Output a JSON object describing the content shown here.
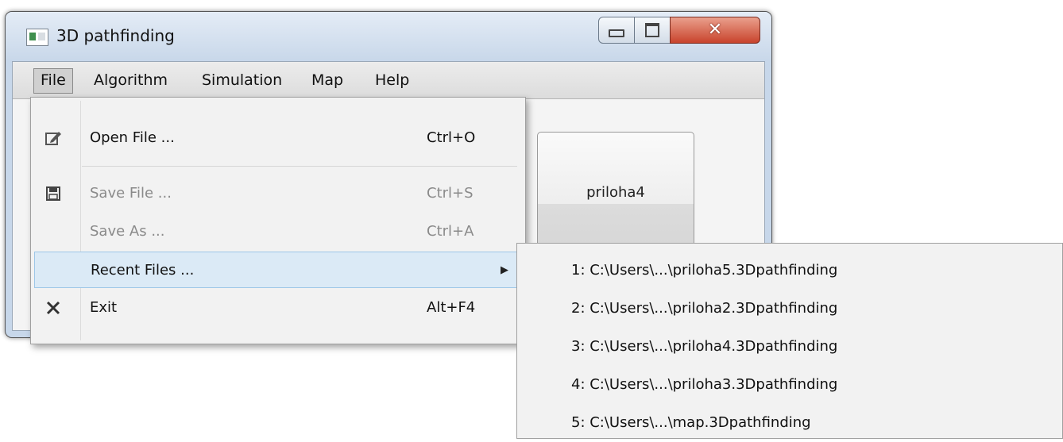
{
  "window": {
    "title": "3D pathfinding",
    "icon": "app-window-icon",
    "controls": {
      "minimize": "minimize-icon",
      "maximize": "maximize-icon",
      "close": "✕"
    }
  },
  "menubar": {
    "items": [
      "File",
      "Algorithm",
      "Simulation",
      "Map",
      "Help"
    ],
    "active": "File"
  },
  "content": {
    "button_label": "priloha4"
  },
  "file_menu": {
    "items": [
      {
        "label": "Open File ...",
        "shortcut": "Ctrl+O",
        "icon": "edit-icon",
        "enabled": true
      },
      {
        "label": "Save File ...",
        "shortcut": "Ctrl+S",
        "icon": "save-icon",
        "enabled": false
      },
      {
        "label": "Save As ...",
        "shortcut": "Ctrl+A",
        "icon": "",
        "enabled": false
      },
      {
        "label": "Recent Files ...",
        "shortcut": "",
        "icon": "",
        "enabled": true,
        "submenu": true
      },
      {
        "label": "Exit",
        "shortcut": "Alt+F4",
        "icon": "close-icon",
        "enabled": true
      }
    ]
  },
  "recent_files": [
    "1:  C:\\Users\\...\\priloha5.3Dpathfinding",
    "2:  C:\\Users\\...\\priloha2.3Dpathfinding",
    "3:  C:\\Users\\...\\priloha4.3Dpathfinding",
    "4:  C:\\Users\\...\\priloha3.3Dpathfinding",
    "5:  C:\\Users\\...\\map.3Dpathfinding"
  ]
}
